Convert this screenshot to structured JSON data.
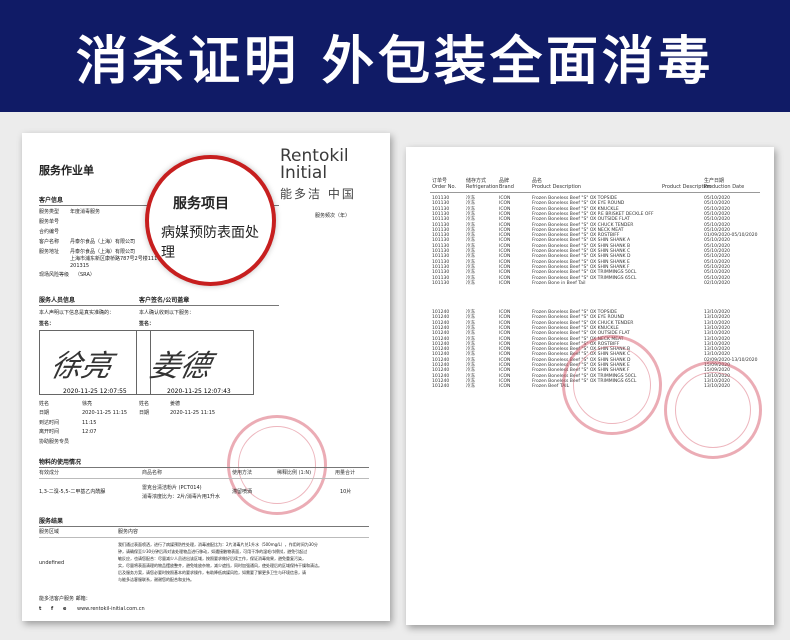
{
  "banner": {
    "title": "消杀证明  外包装全面消毒",
    "bg_color": "#101b66"
  },
  "left_doc": {
    "title": "服务作业单",
    "brand_line1": "Rentokil",
    "brand_line2": "Initial",
    "brand_cn": "能多洁  中国",
    "customer_section": "客户信息",
    "customer_rows": [
      {
        "label": "服务类型",
        "value": "年度消毒服务"
      },
      {
        "label": "服务单号",
        "value": ""
      },
      {
        "label": "合约编号",
        "value": ""
      },
      {
        "label": "客户名称",
        "value": "丹泰尔食品（上海）有限公司"
      },
      {
        "label": "服务地址",
        "value": "丹泰尔食品（上海）有限公司"
      },
      {
        "label": "",
        "value": "上海市浦东新区康桥路787号2号楼1116室"
      },
      {
        "label": "",
        "value": "201315"
      },
      {
        "label": "现场风险等级",
        "value": "（SRA）"
      }
    ],
    "service_freq": "服务频次（年）",
    "magnify": {
      "title": "服务项目",
      "body": "病媒预防表面处理"
    },
    "staff_section": "服务人员信息",
    "staff_statement": "本人声明以下信息是真实准确的：",
    "staff_sign": "签名：",
    "staff_signature": "徐亮",
    "staff_timestamp": "2020-11-25 12:07:55",
    "client_section": "客户签名/公司盖章",
    "client_statement": "本人确认收到以下服务：",
    "client_sign": "签名：",
    "client_signature": "姜德",
    "client_timestamp": "2020-11-25 12:07:43",
    "info_rows": [
      {
        "label": "姓名",
        "left": "徐亮",
        "mid_label": "姓名",
        "right": "姜德"
      },
      {
        "label": "日期",
        "left": "2020-11-25 11:15",
        "mid_label": "日期",
        "right": "2020-11-25 11:15"
      },
      {
        "label": "到达时间",
        "left": "11:15",
        "mid_label": "",
        "right": ""
      },
      {
        "label": "离开时间",
        "left": "12:07",
        "mid_label": "",
        "right": ""
      },
      {
        "label": "协助服务专员",
        "left": "",
        "mid_label": "",
        "right": ""
      }
    ],
    "material_section": "物料的使用情况",
    "material_headers": [
      "有效成分",
      "商品名称",
      "使用方法",
      "稀释比例 (1:N)",
      "用量合计"
    ],
    "material_row": {
      "ingredient": "1,3-二溴-5,5-二甲基乙内酰脲",
      "product": "雷克台清洁粉片 (PCT014)",
      "method": "滞留喷洒",
      "dilution": "",
      "amount": "10片"
    },
    "material_note": "消毒浓度比为：2片/消毒片用1升水",
    "service_section": "服务结果",
    "service_headers": [
      "服务区域",
      "服务内容"
    ],
    "service_area": "undefined",
    "service_content": [
      "我们通过表面喷洒，进行了病媒预防性处理，消毒液配比为：2片消毒片兑1升水（500mg/L），作用时间为30分",
      "钟，请确保至少30分钟后再对该处理物品进行移动，如遇接触物表面，可用干净的湿毛巾擦拭，避免引起过",
      "敏反应，也请您配合：尽量减少人员进出该区域，按照要求做好后续工作，保证消毒效果，避免重复污染，",
      "实，尽量将表面清理的物品摆放整齐，避免堆放杂物，减少遮挡，同时加强通风，使处理后的区域保持干燥和清洁。",
      "后及服务方案，请您必要时按照基本的要求操作，有助降低病媒风险，如需要了解更多卫生与环境信息，请",
      "与能多洁客服联系，谢谢您的配合和支持。"
    ],
    "footer_label": "能多洁客户服务  邮箱：",
    "footer_url": "www.rentokil-initial.com.cn",
    "footer_icons": [
      "t",
      "f",
      "e"
    ]
  },
  "right_doc": {
    "headers": [
      {
        "cn": "订单号",
        "en": "Order No."
      },
      {
        "cn": "储存方式",
        "en": "Refrigeration"
      },
      {
        "cn": "品牌",
        "en": "Brand"
      },
      {
        "cn": "品名",
        "en": "Product Description"
      },
      {
        "cn": "",
        "en": "Product Description"
      },
      {
        "cn": "生产日期",
        "en": "Production Date"
      }
    ],
    "block1": [
      {
        "order": "101130",
        "ref": "冷冻",
        "brand": "ICON",
        "desc": "Frozen Boneless Beef \"S\" OX TOPSIDE",
        "date": "05/10/2020"
      },
      {
        "order": "101130",
        "ref": "冷冻",
        "brand": "ICON",
        "desc": "Frozen Boneless Beef \"S\" OX EYE ROUND",
        "date": "05/10/2020"
      },
      {
        "order": "101130",
        "ref": "冷冻",
        "brand": "ICON",
        "desc": "Frozen Boneless Beef \"S\" OX KNUCKLE",
        "date": "05/10/2020"
      },
      {
        "order": "101130",
        "ref": "冷冻",
        "brand": "ICON",
        "desc": "Frozen Boneless Beef \"S\" OX P.E BRISKET DECKLE OFF",
        "date": "05/10/2020"
      },
      {
        "order": "101130",
        "ref": "冷冻",
        "brand": "ICON",
        "desc": "Frozen Boneless Beef \"S\" OX OUTSIDE FLAT",
        "date": "05/10/2020"
      },
      {
        "order": "101130",
        "ref": "冷冻",
        "brand": "ICON",
        "desc": "Frozen Boneless Beef \"S\" OX CHUCK TENDER",
        "date": "05/10/2020"
      },
      {
        "order": "101130",
        "ref": "冷冻",
        "brand": "ICON",
        "desc": "Frozen Boneless Beef \"S\" OX NECK MEAT",
        "date": "05/10/2020"
      },
      {
        "order": "101130",
        "ref": "冷冻",
        "brand": "ICON",
        "desc": "Frozen Boneless Beef \"S\" OX ROSTBIFF",
        "date": "01/09/2020-05/10/2020"
      },
      {
        "order": "101130",
        "ref": "冷冻",
        "brand": "ICON",
        "desc": "Frozen Boneless Beef \"S\" OX SHIN SHANK A",
        "date": "05/10/2020"
      },
      {
        "order": "101130",
        "ref": "冷冻",
        "brand": "ICON",
        "desc": "Frozen Boneless Beef \"S\" OX SHIN SHANK B",
        "date": "05/10/2020"
      },
      {
        "order": "101130",
        "ref": "冷冻",
        "brand": "ICON",
        "desc": "Frozen Boneless Beef \"S\" OX SHIN SHANK C",
        "date": "05/10/2020"
      },
      {
        "order": "101130",
        "ref": "冷冻",
        "brand": "ICON",
        "desc": "Frozen Boneless Beef \"S\" OX SHIN SHANK D",
        "date": "05/10/2020"
      },
      {
        "order": "101130",
        "ref": "冷冻",
        "brand": "ICON",
        "desc": "Frozen Boneless Beef \"S\" OX SHIN SHANK E",
        "date": "05/10/2020"
      },
      {
        "order": "101130",
        "ref": "冷冻",
        "brand": "ICON",
        "desc": "Frozen Boneless Beef \"S\" OX SHIN SHANK F",
        "date": "05/10/2020"
      },
      {
        "order": "101130",
        "ref": "冷冻",
        "brand": "ICON",
        "desc": "Frozen Boneless Beef \"S\" OX TRIMMINGS 50CL",
        "date": "05/10/2020"
      },
      {
        "order": "101130",
        "ref": "冷冻",
        "brand": "ICON",
        "desc": "Frozen Boneless Beef \"S\" OX TRIMMINGS 65CL",
        "date": "05/10/2020"
      },
      {
        "order": "101130",
        "ref": "冷冻",
        "brand": "ICON",
        "desc": "Frozen Bone in Beef Tail",
        "date": "02/10/2020"
      }
    ],
    "block2": [
      {
        "order": "101240",
        "ref": "冷冻",
        "brand": "ICON",
        "desc": "Frozen Boneless Beef \"S\" OX TOPSIDE",
        "date": "13/10/2020"
      },
      {
        "order": "101240",
        "ref": "冷冻",
        "brand": "ICON",
        "desc": "Frozen Boneless Beef \"S\" OX EYE ROUND",
        "date": "13/10/2020"
      },
      {
        "order": "101240",
        "ref": "冷冻",
        "brand": "ICON",
        "desc": "Frozen Boneless Beef \"S\" OX CHUCK TENDER",
        "date": "13/10/2020"
      },
      {
        "order": "101240",
        "ref": "冷冻",
        "brand": "ICON",
        "desc": "Frozen Boneless Beef \"S\" OX KNUCKLE",
        "date": "13/10/2020"
      },
      {
        "order": "101240",
        "ref": "冷冻",
        "brand": "ICON",
        "desc": "Frozen Boneless Beef \"S\" OX OUTSIDE FLAT",
        "date": "13/10/2020"
      },
      {
        "order": "101240",
        "ref": "冷冻",
        "brand": "ICON",
        "desc": "Frozen Boneless Beef \"S\" OX NECK MEAT",
        "date": "13/10/2020"
      },
      {
        "order": "101240",
        "ref": "冷冻",
        "brand": "ICON",
        "desc": "Frozen Boneless Beef \"S\" OX ROSTBIFF",
        "date": "13/10/2020"
      },
      {
        "order": "101240",
        "ref": "冷冻",
        "brand": "ICON",
        "desc": "Frozen Boneless Beef \"S\" OX SHIN SHANK B",
        "date": "13/10/2020"
      },
      {
        "order": "101240",
        "ref": "冷冻",
        "brand": "ICON",
        "desc": "Frozen Boneless Beef \"S\" OX SHIN SHANK C",
        "date": "13/10/2020"
      },
      {
        "order": "101240",
        "ref": "冷冻",
        "brand": "ICON",
        "desc": "Frozen Boneless Beef \"S\" OX SHIN SHANK D",
        "date": "02/09/2020-13/10/2020"
      },
      {
        "order": "101240",
        "ref": "冷冻",
        "brand": "ICON",
        "desc": "Frozen Boneless Beef \"S\" OX SHIN SHANK E",
        "date": "15/09/2020"
      },
      {
        "order": "101240",
        "ref": "冷冻",
        "brand": "ICON",
        "desc": "Frozen Boneless Beef \"S\" OX SHIN SHANK F",
        "date": "15/09/2020"
      },
      {
        "order": "101240",
        "ref": "冷冻",
        "brand": "ICON",
        "desc": "Frozen Boneless Beef \"S\" OX TRIMMINGS 50CL",
        "date": "13/10/2020"
      },
      {
        "order": "101240",
        "ref": "冷冻",
        "brand": "ICON",
        "desc": "Frozen Boneless Beef \"S\" OX TRIMMINGS 65CL",
        "date": "13/10/2020"
      },
      {
        "order": "101240",
        "ref": "冷冻",
        "brand": "ICON",
        "desc": "Frozen Beef TAIL",
        "date": "13/10/2020"
      }
    ]
  },
  "colors": {
    "stamp": "#d2465a",
    "magnify_border": "#c71f1f"
  }
}
